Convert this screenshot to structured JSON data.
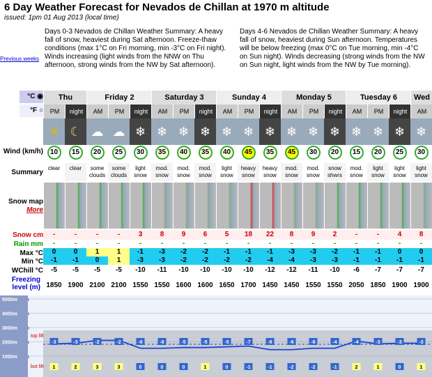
{
  "header": {
    "title": "6 Day Weather Forecast for Nevados de Chillan at 1970 m altitude",
    "issued": "issued: 1pm 01 Aug 2013 (local time)"
  },
  "summaries": {
    "previous_weeks": "Previous weeks",
    "s1": "Days 0-3 Nevados de Chillan Weather Summary: A heavy fall of snow, heaviest during Sat afternoon. Freeze-thaw conditions (max 1°C on Fri morning, min -3°C on Fri night). Winds increasing (light winds from the NNW on Thu afternoon, strong winds from the NW by Sat afternoon).",
    "s2": "Days 4-6 Nevados de Chillan Weather Summary: A heavy fall of snow, heaviest during Sun afternoon. Temperatures will be below freezing (max 0°C on Tue morning, min -4°C on Sun night). Winds decreasing (strong winds from the NW on Sun night, light winds from the NW by Tue morning)."
  },
  "units": {
    "c": "°C",
    "f": "°F"
  },
  "days": [
    {
      "label": "Thu",
      "cols": 2
    },
    {
      "label": "Friday 2",
      "cols": 3
    },
    {
      "label": "Saturday 3",
      "cols": 3
    },
    {
      "label": "Sunday 4",
      "cols": 3
    },
    {
      "label": "Monday 5",
      "cols": 3
    },
    {
      "label": "Tuesday 6",
      "cols": 3
    },
    {
      "label": "Wed",
      "cols": 1
    }
  ],
  "periods": [
    "PM",
    "night",
    "AM",
    "PM",
    "night",
    "AM",
    "PM",
    "night",
    "AM",
    "PM",
    "night",
    "AM",
    "PM",
    "night",
    "AM",
    "PM",
    "night",
    "AM"
  ],
  "labels": {
    "wind": "Wind (km/h)",
    "summary": "Summary",
    "snowmap": "Snow map",
    "more": "More",
    "snow": "Snow cm",
    "rain": "Rain mm",
    "max": "Max °C",
    "min": "Min °C",
    "wchill": "WChill °C",
    "freezing": "Freezing level (m)"
  },
  "wind": [
    "10",
    "15",
    "20",
    "25",
    "30",
    "35",
    "40",
    "35",
    "40",
    "45",
    "35",
    "45",
    "30",
    "20",
    "15",
    "20",
    "25",
    "30"
  ],
  "summary": [
    "clear",
    "clear",
    "some clouds",
    "some clouds",
    "light snow",
    "mod. snow",
    "mod. snow",
    "mod. snow",
    "light snow",
    "heavy snow",
    "heavy snow",
    "mod. snow",
    "mod. snow",
    "snow shwrs",
    "mod. snow",
    "light snow",
    "light snow",
    "light snow"
  ],
  "snow": [
    "-",
    "-",
    "-",
    "-",
    "3",
    "8",
    "9",
    "6",
    "5",
    "18",
    "22",
    "8",
    "9",
    "2",
    "-",
    "-",
    "4",
    "8"
  ],
  "rain": [
    "-",
    "-",
    "-",
    "-",
    "-",
    "-",
    "-",
    "-",
    "-",
    "-",
    "-",
    "-",
    "-",
    "-",
    "-",
    "-",
    "-",
    "-"
  ],
  "max": [
    "0",
    "0",
    "1",
    "1",
    "-1",
    "-3",
    "-2",
    "-2",
    "-1",
    "-1",
    "-1",
    "-3",
    "-3",
    "-2",
    "-1",
    "-1",
    "0",
    "0"
  ],
  "min": [
    "-1",
    "-1",
    "0",
    "1",
    "-3",
    "-3",
    "-2",
    "-2",
    "-2",
    "-2",
    "-4",
    "-4",
    "-3",
    "-3",
    "-1",
    "-1",
    "-1",
    "-1"
  ],
  "wchill": [
    "-5",
    "-5",
    "-5",
    "-5",
    "-10",
    "-11",
    "-10",
    "-10",
    "-10",
    "-10",
    "-12",
    "-12",
    "-11",
    "-10",
    "-6",
    "-7",
    "-7",
    "-7"
  ],
  "freezing": [
    "1850",
    "1900",
    "2100",
    "2100",
    "1550",
    "1550",
    "1600",
    "1600",
    "1650",
    "1700",
    "1450",
    "1450",
    "1550",
    "1550",
    "2050",
    "1850",
    "1900",
    "1900"
  ],
  "chart": {
    "levels": [
      "5000m",
      "4000m",
      "3000m",
      "2000m",
      "1000m"
    ],
    "top_lift": "top lift",
    "bot_lift": "bot lift",
    "top_values": [
      "-3",
      "-3",
      "-2",
      "-2",
      "-6",
      "-6",
      "-5",
      "-5",
      "-5",
      "-7",
      "-6",
      "-6",
      "-6",
      "-4",
      "-4",
      "-3",
      "-3",
      "-3"
    ],
    "bot_values": [
      "1",
      "2",
      "3",
      "3",
      "0",
      "0",
      "0",
      "1",
      "0",
      "-1",
      "-1",
      "-2",
      "-2",
      "-1",
      "2",
      "1",
      "0",
      "1"
    ]
  },
  "colors": {
    "wind_ring": "#33aa33",
    "snow_text": "#cc0000",
    "temp_band": "#22ccee",
    "night": "#333333"
  }
}
